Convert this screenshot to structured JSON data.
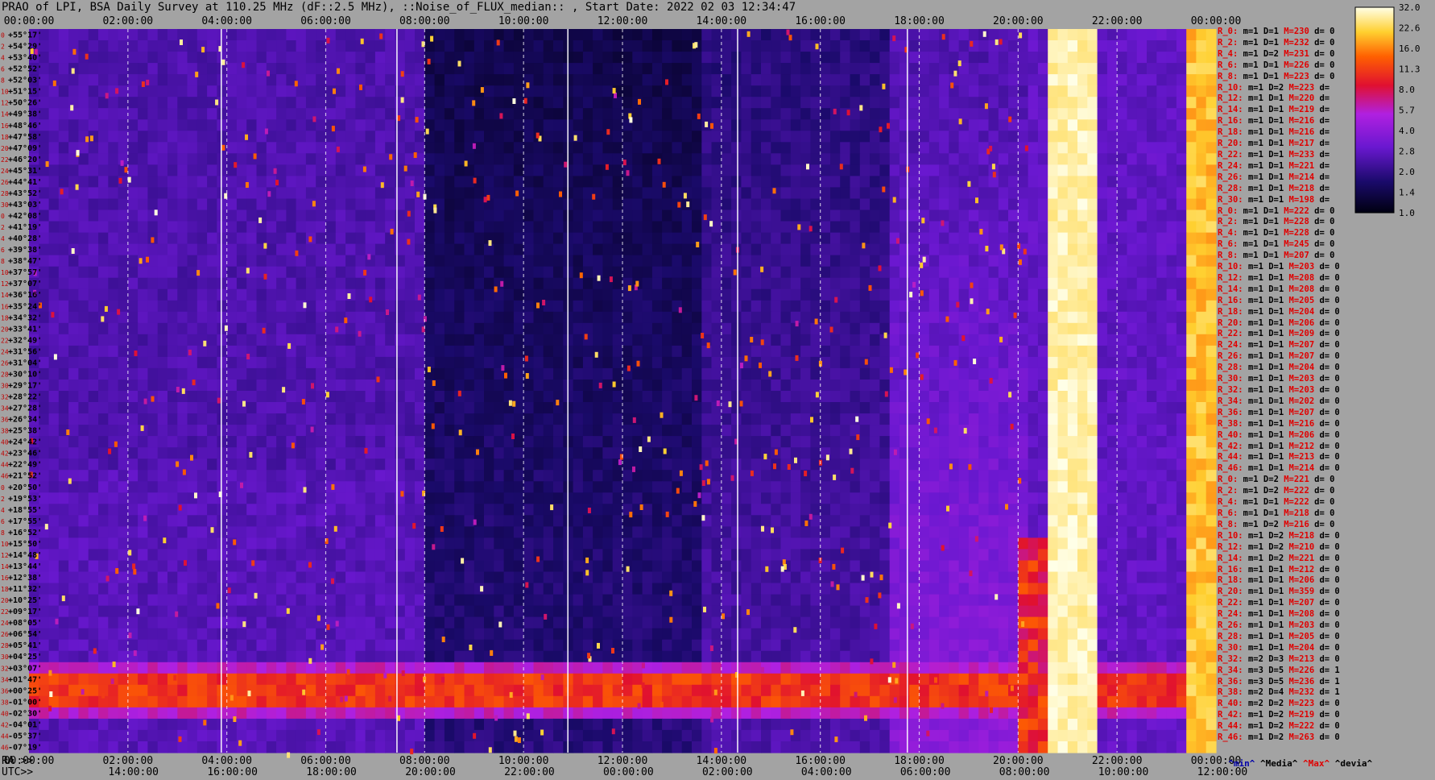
{
  "window": {
    "title": "PRAO of LPI, BSA Daily Survey at 110.25 MHz (dF::2.5 MHz), ::Noise_of_FLUX_median:: , Start Date: 2022 02 03 12:34:47"
  },
  "colors": {
    "background": "#a3a3a3",
    "low": "#0a0020",
    "mid": "#7a1cd9",
    "high": "#ff3300",
    "max": "#ffffd0"
  },
  "chart_data": {
    "type": "heatmap",
    "title": "PRAO of LPI, BSA Daily Survey at 110.25 MHz (dF::2.5 MHz), ::Noise_of_FLUX_median:: , Start Date: 2022 02 03 12:34:47",
    "x_top_ticks": [
      "00:00:00",
      "02:00:00",
      "04:00:00",
      "06:00:00",
      "08:00:00",
      "10:00:00",
      "12:00:00",
      "14:00:00",
      "16:00:00",
      "18:00:00",
      "20:00:00",
      "22:00:00",
      "00:00:00"
    ],
    "x_bottom_ra_label": "RA >>",
    "x_bottom_ra_ticks": [
      "00:00:00",
      "02:00:00",
      "04:00:00",
      "06:00:00",
      "08:00:00",
      "10:00:00",
      "12:00:00",
      "14:00:00",
      "16:00:00",
      "18:00:00",
      "20:00:00",
      "22:00:00",
      "00:00:00"
    ],
    "x_bottom_utc_label": "UTC>>",
    "x_bottom_utc_ticks": [
      "14:00:00",
      "16:00:00",
      "18:00:00",
      "20:00:00",
      "22:00:00",
      "00:00:00",
      "02:00:00",
      "04:00:00",
      "06:00:00",
      "08:00:00",
      "10:00:00",
      "12:00:00"
    ],
    "y_ticks": [
      "+55°17'",
      "+54°29'",
      "+53°40'",
      "+52°52'",
      "+52°03'",
      "+51°15'",
      "+50°26'",
      "+49°38'",
      "+48°46'",
      "+47°58'",
      "+47°09'",
      "+46°20'",
      "+45°31'",
      "+44°41'",
      "+43°52'",
      "+43°03'",
      "+42°08'",
      "+41°19'",
      "+40°28'",
      "+39°38'",
      "+38°47'",
      "+37°57'",
      "+37°07'",
      "+36°16'",
      "+35°24'",
      "+34°32'",
      "+33°41'",
      "+32°49'",
      "+31°56'",
      "+31°04'",
      "+30°10'",
      "+29°17'",
      "+28°22'",
      "+27°28'",
      "+26°34'",
      "+25°38'",
      "+24°42'",
      "+23°46'",
      "+22°49'",
      "+21°52'",
      "+20°50'",
      "+19°53'",
      "+18°55'",
      "+17°55'",
      "+16°52'",
      "+15°50'",
      "+14°48'",
      "+13°44'",
      "+12°38'",
      "+11°32'",
      "+10°25'",
      "+09°17'",
      "+08°05'",
      "+06°54'",
      "+05°41'",
      "+04°25'",
      "+03°07'",
      "+01°47'",
      "+00°25'",
      "-01°00'",
      "-02°30'",
      "-04°01'",
      "-05°37'",
      "-07°19'"
    ],
    "beam_index_ticks": [
      "0",
      "2",
      "4",
      "6",
      "8",
      "10",
      "12",
      "14",
      "16",
      "18",
      "20",
      "22",
      "24",
      "26",
      "28",
      "30",
      "0",
      "2",
      "4",
      "6",
      "8",
      "10",
      "12",
      "14",
      "16",
      "18",
      "20",
      "22",
      "24",
      "26",
      "28",
      "30",
      "32",
      "34",
      "36",
      "38",
      "40",
      "42",
      "44",
      "46",
      "0",
      "2",
      "4",
      "6",
      "8",
      "10",
      "12",
      "14",
      "16",
      "18",
      "20",
      "22",
      "24",
      "26",
      "28",
      "30",
      "32",
      "34",
      "36",
      "38",
      "40",
      "42",
      "44",
      "46"
    ],
    "colorbar": {
      "ticks": [
        "32.0",
        "22.6",
        "16.0",
        "11.3",
        "8.0",
        "5.7",
        "4.0",
        "2.8",
        "2.0",
        "1.4",
        "1.0"
      ],
      "range": [
        1.0,
        32.0
      ],
      "scale": "log"
    },
    "grid": true
  },
  "stats": {
    "rows": [
      {
        "r": "R_0:",
        "m": "m=1",
        "D": "D=1",
        "M": "M=230",
        "d": "d= 0"
      },
      {
        "r": "R_2:",
        "m": "m=1",
        "D": "D=1",
        "M": "M=232",
        "d": "d= 0"
      },
      {
        "r": "R_4:",
        "m": "m=1",
        "D": "D=2",
        "M": "M=231",
        "d": "d= 0"
      },
      {
        "r": "R_6:",
        "m": "m=1",
        "D": "D=1",
        "M": "M=226",
        "d": "d= 0"
      },
      {
        "r": "R_8:",
        "m": "m=1",
        "D": "D=1",
        "M": "M=223",
        "d": "d= 0"
      },
      {
        "r": "R_10:",
        "m": "m=1",
        "D": "D=2",
        "M": "M=223",
        "d": "d="
      },
      {
        "r": "R_12:",
        "m": "m=1",
        "D": "D=1",
        "M": "M=220",
        "d": "d="
      },
      {
        "r": "R_14:",
        "m": "m=1",
        "D": "D=1",
        "M": "M=219",
        "d": "d="
      },
      {
        "r": "R_16:",
        "m": "m=1",
        "D": "D=1",
        "M": "M=216",
        "d": "d="
      },
      {
        "r": "R_18:",
        "m": "m=1",
        "D": "D=1",
        "M": "M=216",
        "d": "d="
      },
      {
        "r": "R_20:",
        "m": "m=1",
        "D": "D=1",
        "M": "M=217",
        "d": "d="
      },
      {
        "r": "R_22:",
        "m": "m=1",
        "D": "D=1",
        "M": "M=233",
        "d": "d="
      },
      {
        "r": "R_24:",
        "m": "m=1",
        "D": "D=1",
        "M": "M=221",
        "d": "d="
      },
      {
        "r": "R_26:",
        "m": "m=1",
        "D": "D=1",
        "M": "M=214",
        "d": "d="
      },
      {
        "r": "R_28:",
        "m": "m=1",
        "D": "D=1",
        "M": "M=218",
        "d": "d="
      },
      {
        "r": "R_30:",
        "m": "m=1",
        "D": "D=1",
        "M": "M=198",
        "d": "d="
      },
      {
        "r": "R_0:",
        "m": "m=1",
        "D": "D=1",
        "M": "M=222",
        "d": "d= 0"
      },
      {
        "r": "R_2:",
        "m": "m=1",
        "D": "D=1",
        "M": "M=228",
        "d": "d= 0"
      },
      {
        "r": "R_4:",
        "m": "m=1",
        "D": "D=1",
        "M": "M=228",
        "d": "d= 0"
      },
      {
        "r": "R_6:",
        "m": "m=1",
        "D": "D=1",
        "M": "M=245",
        "d": "d= 0"
      },
      {
        "r": "R_8:",
        "m": "m=1",
        "D": "D=1",
        "M": "M=207",
        "d": "d= 0"
      },
      {
        "r": "R_10:",
        "m": "m=1",
        "D": "D=1",
        "M": "M=203",
        "d": "d= 0"
      },
      {
        "r": "R_12:",
        "m": "m=1",
        "D": "D=1",
        "M": "M=208",
        "d": "d= 0"
      },
      {
        "r": "R_14:",
        "m": "m=1",
        "D": "D=1",
        "M": "M=208",
        "d": "d= 0"
      },
      {
        "r": "R_16:",
        "m": "m=1",
        "D": "D=1",
        "M": "M=205",
        "d": "d= 0"
      },
      {
        "r": "R_18:",
        "m": "m=1",
        "D": "D=1",
        "M": "M=204",
        "d": "d= 0"
      },
      {
        "r": "R_20:",
        "m": "m=1",
        "D": "D=1",
        "M": "M=206",
        "d": "d= 0"
      },
      {
        "r": "R_22:",
        "m": "m=1",
        "D": "D=1",
        "M": "M=209",
        "d": "d= 0"
      },
      {
        "r": "R_24:",
        "m": "m=1",
        "D": "D=1",
        "M": "M=207",
        "d": "d= 0"
      },
      {
        "r": "R_26:",
        "m": "m=1",
        "D": "D=1",
        "M": "M=207",
        "d": "d= 0"
      },
      {
        "r": "R_28:",
        "m": "m=1",
        "D": "D=1",
        "M": "M=204",
        "d": "d= 0"
      },
      {
        "r": "R_30:",
        "m": "m=1",
        "D": "D=1",
        "M": "M=203",
        "d": "d= 0"
      },
      {
        "r": "R_32:",
        "m": "m=1",
        "D": "D=1",
        "M": "M=203",
        "d": "d= 0"
      },
      {
        "r": "R_34:",
        "m": "m=1",
        "D": "D=1",
        "M": "M=202",
        "d": "d= 0"
      },
      {
        "r": "R_36:",
        "m": "m=1",
        "D": "D=1",
        "M": "M=207",
        "d": "d= 0"
      },
      {
        "r": "R_38:",
        "m": "m=1",
        "D": "D=1",
        "M": "M=216",
        "d": "d= 0"
      },
      {
        "r": "R_40:",
        "m": "m=1",
        "D": "D=1",
        "M": "M=206",
        "d": "d= 0"
      },
      {
        "r": "R_42:",
        "m": "m=1",
        "D": "D=1",
        "M": "M=212",
        "d": "d= 0"
      },
      {
        "r": "R_44:",
        "m": "m=1",
        "D": "D=1",
        "M": "M=213",
        "d": "d= 0"
      },
      {
        "r": "R_46:",
        "m": "m=1",
        "D": "D=1",
        "M": "M=214",
        "d": "d= 0"
      },
      {
        "r": "R_0:",
        "m": "m=1",
        "D": "D=2",
        "M": "M=221",
        "d": "d= 0"
      },
      {
        "r": "R_2:",
        "m": "m=1",
        "D": "D=2",
        "M": "M=222",
        "d": "d= 0"
      },
      {
        "r": "R_4:",
        "m": "m=1",
        "D": "D=1",
        "M": "M=222",
        "d": "d= 0"
      },
      {
        "r": "R_6:",
        "m": "m=1",
        "D": "D=1",
        "M": "M=218",
        "d": "d= 0"
      },
      {
        "r": "R_8:",
        "m": "m=1",
        "D": "D=2",
        "M": "M=216",
        "d": "d= 0"
      },
      {
        "r": "R_10:",
        "m": "m=1",
        "D": "D=2",
        "M": "M=218",
        "d": "d= 0"
      },
      {
        "r": "R_12:",
        "m": "m=1",
        "D": "D=2",
        "M": "M=210",
        "d": "d= 0"
      },
      {
        "r": "R_14:",
        "m": "m=1",
        "D": "D=2",
        "M": "M=221",
        "d": "d= 0"
      },
      {
        "r": "R_16:",
        "m": "m=1",
        "D": "D=1",
        "M": "M=212",
        "d": "d= 0"
      },
      {
        "r": "R_18:",
        "m": "m=1",
        "D": "D=1",
        "M": "M=206",
        "d": "d= 0"
      },
      {
        "r": "R_20:",
        "m": "m=1",
        "D": "D=1",
        "M": "M=359",
        "d": "d= 0"
      },
      {
        "r": "R_22:",
        "m": "m=1",
        "D": "D=1",
        "M": "M=207",
        "d": "d= 0"
      },
      {
        "r": "R_24:",
        "m": "m=1",
        "D": "D=1",
        "M": "M=208",
        "d": "d= 0"
      },
      {
        "r": "R_26:",
        "m": "m=1",
        "D": "D=1",
        "M": "M=203",
        "d": "d= 0"
      },
      {
        "r": "R_28:",
        "m": "m=1",
        "D": "D=1",
        "M": "M=205",
        "d": "d= 0"
      },
      {
        "r": "R_30:",
        "m": "m=1",
        "D": "D=1",
        "M": "M=204",
        "d": "d= 0"
      },
      {
        "r": "R_32:",
        "m": "m=2",
        "D": "D=3",
        "M": "M=213",
        "d": "d= 0"
      },
      {
        "r": "R_34:",
        "m": "m=3",
        "D": "D=5",
        "M": "M=226",
        "d": "d= 1"
      },
      {
        "r": "R_36:",
        "m": "m=3",
        "D": "D=5",
        "M": "M=236",
        "d": "d= 1"
      },
      {
        "r": "R_38:",
        "m": "m=2",
        "D": "D=4",
        "M": "M=232",
        "d": "d= 1"
      },
      {
        "r": "R_40:",
        "m": "m=2",
        "D": "D=2",
        "M": "M=223",
        "d": "d= 0"
      },
      {
        "r": "R_42:",
        "m": "m=1",
        "D": "D=2",
        "M": "M=219",
        "d": "d= 0"
      },
      {
        "r": "R_44:",
        "m": "m=1",
        "D": "D=2",
        "M": "M=222",
        "d": "d= 0"
      },
      {
        "r": "R_46:",
        "m": "m=1",
        "D": "D=2",
        "M": "M=263",
        "d": "d= 0"
      }
    ],
    "footer": {
      "min": "^min^",
      "median": "^Media^",
      "max": "^Max^",
      "dev": "^devia^"
    }
  }
}
